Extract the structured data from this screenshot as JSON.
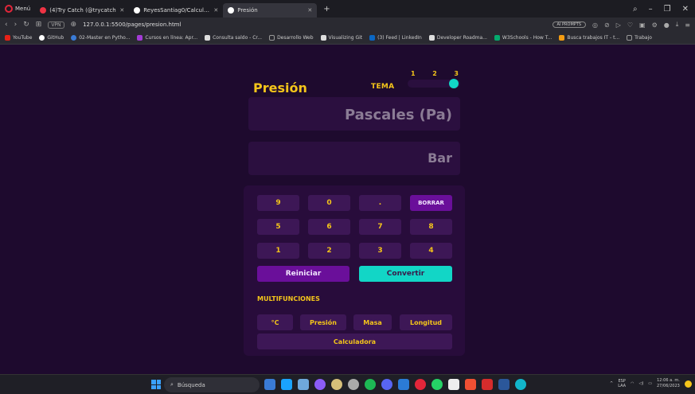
{
  "browser": {
    "menu_label": "Menú",
    "tabs": [
      {
        "label": "(4)Try Catch (@trycatch"
      },
      {
        "label": "ReyesSantiag0/Calculadora"
      },
      {
        "label": "Presión"
      }
    ],
    "new_tab": "+",
    "url": "127.0.0.1:5500/pages/presion.html",
    "vpn": "VPN",
    "ai_prompts": "AI PROMPTS",
    "bookmarks": [
      {
        "label": "YouTube",
        "color": "#e62117"
      },
      {
        "label": "GitHub",
        "color": "#ffffff"
      },
      {
        "label": "02-Master en Pytho...",
        "color": "#3a7bd5"
      },
      {
        "label": "Cursos en línea: Apr...",
        "color": "#a33bd6"
      },
      {
        "label": "Consulta saldo - Cr...",
        "color": "#dddddd"
      },
      {
        "label": "Desarrollo Web",
        "color": "#999999"
      },
      {
        "label": "Visualizing Git",
        "color": "#dddddd"
      },
      {
        "label": "(3) Feed | LinkedIn",
        "color": "#0a66c2"
      },
      {
        "label": "Developer Roadma...",
        "color": "#dddddd"
      },
      {
        "label": "W3Schools - How T...",
        "color": "#04aa6d"
      },
      {
        "label": "Busca trabajos IT - t...",
        "color": "#f39c12"
      },
      {
        "label": "Trabajo",
        "color": "#999999"
      }
    ]
  },
  "app": {
    "title": "Presión",
    "theme_label": "TEMA",
    "theme_numbers": [
      "1",
      "2",
      "3"
    ],
    "theme_selected": 3,
    "display_top": "Pascales (Pa)",
    "display_bottom": "Bar",
    "keys_row1": [
      "9",
      "0",
      ".",
      "BORRAR"
    ],
    "keys_row2": [
      "5",
      "6",
      "7",
      "8"
    ],
    "keys_row3": [
      "1",
      "2",
      "3",
      "4"
    ],
    "reset_label": "Reiniciar",
    "convert_label": "Convertir",
    "multifunctions_label": "MULTIFUNCIONES",
    "multifunctions": [
      "°C",
      "Presión",
      "Masa",
      "Longitud"
    ],
    "calculator_label": "Calculadora",
    "accent_yellow": "#f4c51a",
    "accent_teal": "#12d6c6",
    "accent_purple": "#6a0f9a"
  },
  "taskbar": {
    "search_placeholder": "Búsqueda",
    "lang_top": "ESP",
    "lang_bottom": "LAA",
    "time": "12:06 a. m.",
    "date": "27/06/2023"
  }
}
